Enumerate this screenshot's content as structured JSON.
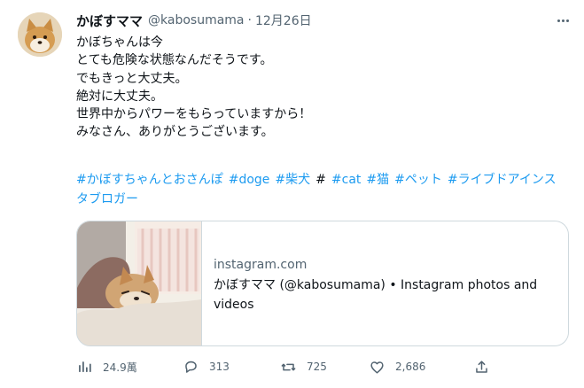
{
  "tweet": {
    "display_name": "かぼすママ",
    "handle": "@kabosumama",
    "separator": "·",
    "date": "12月26日",
    "lines": [
      "かぼちゃんは今",
      "とても危険な状態なんだそうです。",
      "でもきっと大丈夫。",
      "絶対に大丈夫。",
      "世界中からパワーをもらっていますから！",
      "みなさん、ありがとうございます。"
    ],
    "hashtags": [
      "#かぼすちゃんとおさんぽ",
      "#doge",
      "#柴犬",
      "#",
      "#cat",
      "#猫",
      "#ペット",
      "#ライブドアインスタブロガー"
    ]
  },
  "card": {
    "domain": "instagram.com",
    "title": "かぼすママ (@kabosumama) • Instagram photos and videos"
  },
  "actions": {
    "views": "24.9萬",
    "replies": "313",
    "retweets": "725",
    "likes": "2,686"
  },
  "icons": {
    "avatar": "shiba-dog-avatar",
    "more": "more-icon",
    "views": "analytics-icon",
    "reply": "reply-icon",
    "retweet": "retweet-icon",
    "like": "heart-icon",
    "share": "share-icon"
  },
  "colors": {
    "accent": "#1d9bf0",
    "muted": "#536471",
    "border": "#cfd9de"
  }
}
